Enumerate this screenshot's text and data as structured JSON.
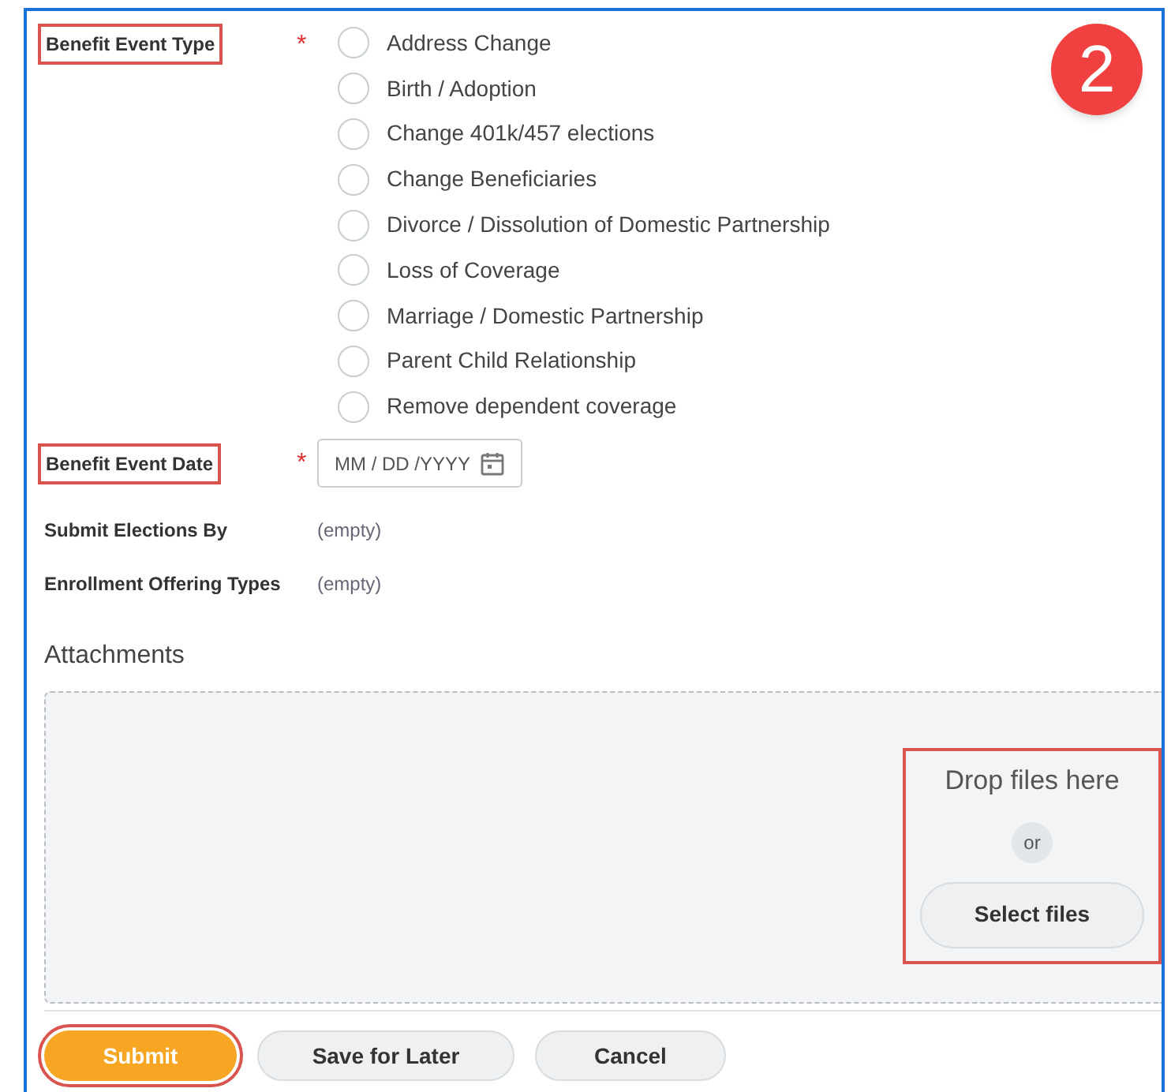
{
  "step_badge": "2",
  "benefit_event_type": {
    "label": "Benefit Event Type",
    "highlighted": true,
    "required_mark": "*",
    "options": [
      {
        "label": "Address Change",
        "selected": false
      },
      {
        "label": "Birth / Adoption",
        "selected": false
      },
      {
        "label": "Change 401k/457 elections",
        "selected": false
      },
      {
        "label": "Change Beneficiaries",
        "selected": false
      },
      {
        "label": "Divorce / Dissolution of Domestic Partnership",
        "selected": false
      },
      {
        "label": "Loss of Coverage",
        "selected": false
      },
      {
        "label": "Marriage / Domestic Partnership",
        "selected": false
      },
      {
        "label": "Parent Child Relationship",
        "selected": false
      },
      {
        "label": "Remove dependent coverage",
        "selected": false
      }
    ]
  },
  "benefit_event_date": {
    "label": "Benefit Event Date",
    "highlighted": true,
    "required_mark": "*",
    "placeholder": "MM / DD /YYYY"
  },
  "fields": [
    {
      "label": "Submit Elections By",
      "value": "(empty)"
    },
    {
      "label": "Enrollment Offering Types",
      "value": "(empty)"
    }
  ],
  "attachments": {
    "title": "Attachments",
    "drop_text": "Drop files here",
    "or_text": "or",
    "select_button": "Select files",
    "highlighted": true
  },
  "buttons": [
    {
      "label": "Submit",
      "kind": "primary",
      "highlighted": true
    },
    {
      "label": "Save for Later",
      "kind": "secondary",
      "highlighted": false
    },
    {
      "label": "Cancel",
      "kind": "secondary",
      "highlighted": false
    }
  ]
}
